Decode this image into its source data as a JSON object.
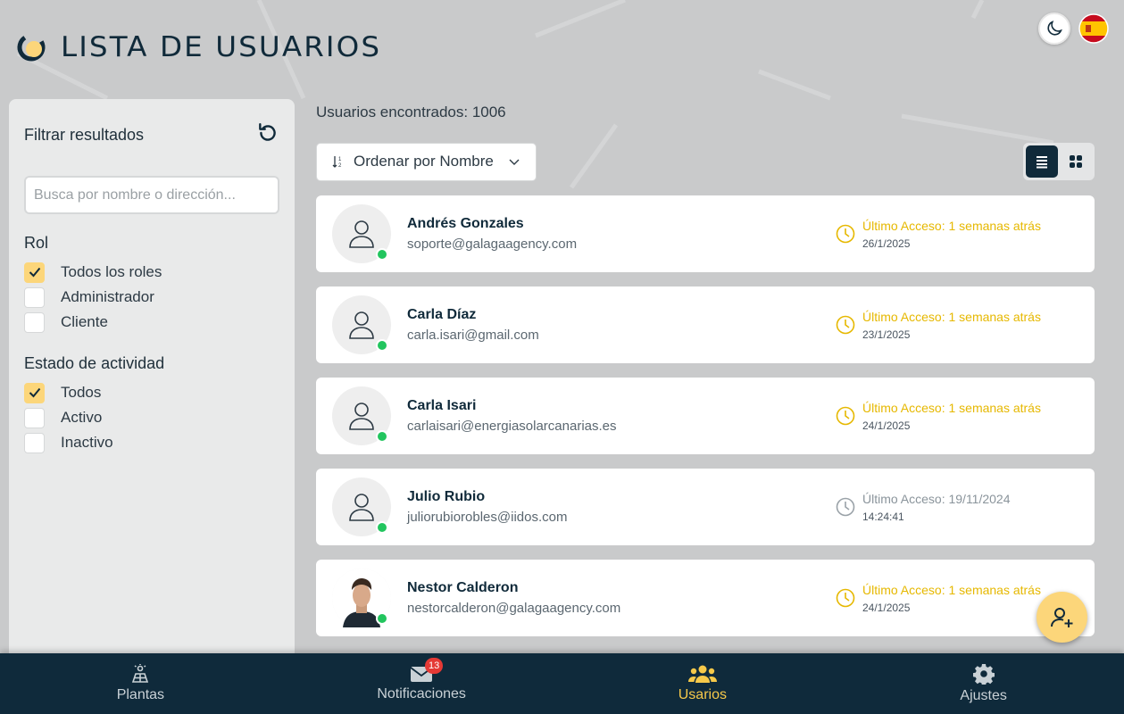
{
  "header": {
    "title": "LISTA DE USUARIOS"
  },
  "top_actions": {
    "theme_icon": "moon-icon",
    "language_icon": "spain-flag-icon"
  },
  "sidebar": {
    "filter_title": "Filtrar resultados",
    "search_placeholder": "Busca por nombre o dirección...",
    "role_title": "Rol",
    "roles": [
      {
        "label": "Todos los roles",
        "checked": true
      },
      {
        "label": "Administrador",
        "checked": false
      },
      {
        "label": "Cliente",
        "checked": false
      }
    ],
    "activity_title": "Estado de actividad",
    "activity": [
      {
        "label": "Todos",
        "checked": true
      },
      {
        "label": "Activo",
        "checked": false
      },
      {
        "label": "Inactivo",
        "checked": false
      }
    ]
  },
  "main": {
    "count_text": "Usuarios encontrados: 1006",
    "sort_label": "Ordenar por Nombre",
    "users": [
      {
        "name": "Andrés Gonzales",
        "email": "soporte@galagaagency.com",
        "access": "Último Acceso: 1 semanas atrás",
        "date": "26/1/2025",
        "recent": true,
        "photo": false
      },
      {
        "name": "Carla Díaz",
        "email": "carla.isari@gmail.com",
        "access": "Último Acceso: 1 semanas atrás",
        "date": "23/1/2025",
        "recent": true,
        "photo": false
      },
      {
        "name": "Carla Isari",
        "email": "carlaisari@energiasolarcanarias.es",
        "access": "Último Acceso: 1 semanas atrás",
        "date": "24/1/2025",
        "recent": true,
        "photo": false
      },
      {
        "name": "Julio Rubio",
        "email": "juliorubiorobles@iidos.com",
        "access": "Último Acceso: 19/11/2024",
        "date": "14:24:41",
        "recent": false,
        "photo": false
      },
      {
        "name": "Nestor Calderon",
        "email": "nestorcalderon@galagaagency.com",
        "access": "Último Acceso: 1 semanas atrás",
        "date": "24/1/2025",
        "recent": true,
        "photo": true
      }
    ]
  },
  "bottom_nav": {
    "items": [
      {
        "label": "Plantas",
        "icon": "solar-panel-icon"
      },
      {
        "label": "Notificaciones",
        "icon": "envelope-icon",
        "badge": "13"
      },
      {
        "label": "Usarios",
        "icon": "users-icon",
        "active": true
      },
      {
        "label": "Ajustes",
        "icon": "gear-icon"
      }
    ]
  },
  "colors": {
    "accent": "#fcd67a",
    "navy": "#0f2a3b",
    "online": "#22c55e",
    "access_recent": "#e6b800"
  }
}
